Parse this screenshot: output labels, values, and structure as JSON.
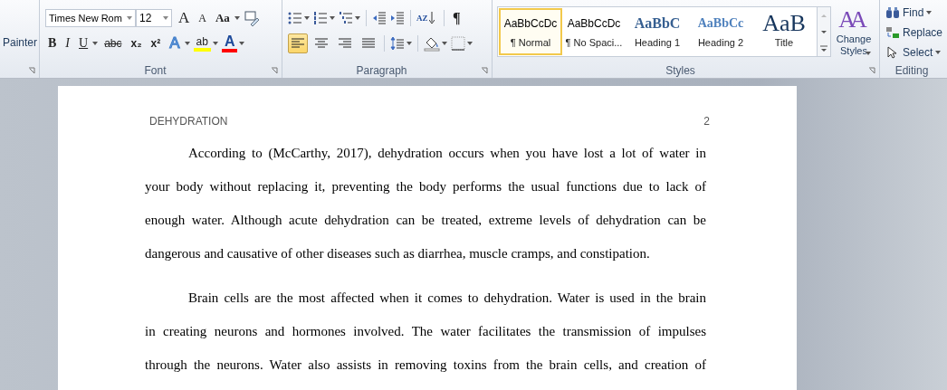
{
  "ribbon": {
    "clipboard": {
      "button_label": "Painter"
    },
    "font": {
      "font_name": "Times New Rom",
      "font_size": "12",
      "row1": [
        {
          "kind": "grow",
          "glyph": "A"
        },
        {
          "kind": "shrink",
          "glyph": "A"
        },
        {
          "kind": "case",
          "glyph": "Aa"
        }
      ],
      "row2": [
        {
          "kind": "bold",
          "glyph": "B"
        },
        {
          "kind": "italic",
          "glyph": "I"
        },
        {
          "kind": "underline",
          "glyph": "U"
        },
        {
          "kind": "strike",
          "glyph": "abc"
        },
        {
          "kind": "sub",
          "glyph": "x₂"
        },
        {
          "kind": "sup",
          "glyph": "x²"
        },
        {
          "kind": "effects",
          "glyph": "A"
        },
        {
          "kind": "highlight",
          "glyph": "ab"
        },
        {
          "kind": "color",
          "glyph": "A"
        }
      ],
      "label": "Font"
    },
    "paragraph": {
      "sort_glyph": "AZ",
      "pilcrow": "¶",
      "alignments": [
        {
          "kind": "left",
          "selected": true
        },
        {
          "kind": "center",
          "selected": false
        },
        {
          "kind": "right",
          "selected": false
        },
        {
          "kind": "justify",
          "selected": false
        }
      ],
      "label": "Paragraph"
    },
    "styles": {
      "items": [
        {
          "preview": "AaBbCcDc",
          "name": "¶ Normal",
          "kind": "normal",
          "selected": true
        },
        {
          "preview": "AaBbCcDc",
          "name": "¶ No Spaci...",
          "kind": "normal",
          "selected": false
        },
        {
          "preview": "AaBbC",
          "name": "Heading 1",
          "kind": "heading1",
          "selected": false
        },
        {
          "preview": "AaBbCc",
          "name": "Heading 2",
          "kind": "heading2",
          "selected": false
        },
        {
          "preview": "AaB",
          "name": "Title",
          "kind": "title",
          "selected": false
        }
      ],
      "change_styles": {
        "glyph": "AA",
        "label": "Change Styles"
      },
      "label": "Styles"
    },
    "editing": {
      "items": [
        {
          "kind": "find",
          "label": "Find",
          "dropdown": true
        },
        {
          "kind": "replace",
          "label": "Replace",
          "dropdown": false
        },
        {
          "kind": "select",
          "label": "Select",
          "dropdown": true
        }
      ],
      "label": "Editing"
    }
  },
  "document": {
    "header": "DEHYDRATION",
    "page_number": "2",
    "paragraphs": [
      {
        "lines": [
          "According to (McCarthy, 2017), dehydration occurs when you have lost a lot of water in",
          "your body without replacing it, preventing the body performs the usual functions due to lack of",
          "enough water. Although acute dehydration can be treated, extreme levels of dehydration can be",
          "dangerous and causative of other diseases such as diarrhea, muscle cramps, and constipation."
        ]
      },
      {
        "lines": [
          "Brain cells are the most affected when it comes to dehydration. Water is used in the brain",
          "in creating neurons and hormones involved. The water facilitates the transmission of impulses",
          "through the neurons. Water also assists in removing toxins from the brain cells, and creation of"
        ]
      }
    ]
  }
}
